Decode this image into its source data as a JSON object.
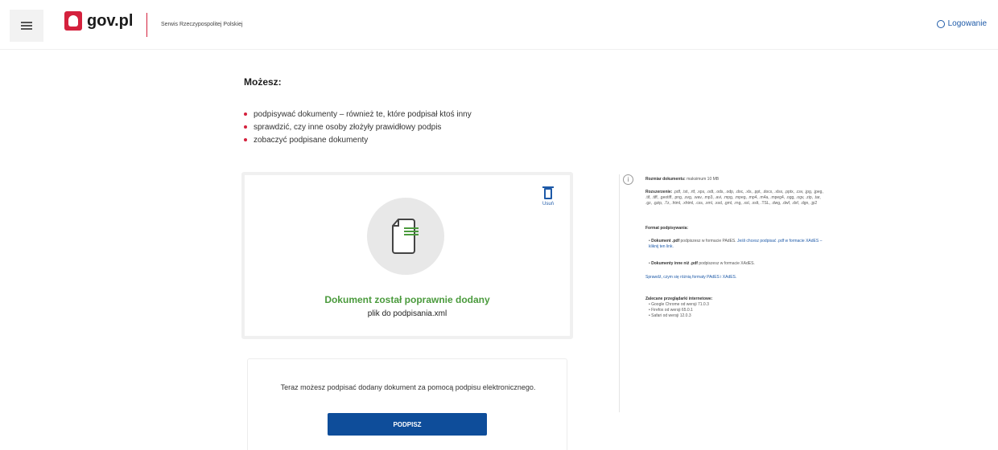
{
  "header": {
    "menu_icon": "hamburger-icon",
    "logo_text": "gov.pl",
    "service_name": "Serwis Rzeczypospolitej Polskiej",
    "login_label": "Logowanie",
    "colors": {
      "brand_red": "#d4213d",
      "link_blue": "#1e5aa8"
    }
  },
  "intro": {
    "title": "Możesz:",
    "items": [
      "podpisywać dokumenty – również te, które podpisał ktoś inny",
      "sprawdzić, czy inne osoby złożyły prawidłowy podpis",
      "zobaczyć podpisane dokumenty"
    ]
  },
  "upload": {
    "delete_label": "Usuń",
    "status": "Dokument został poprawnie dodany",
    "filename": "plik do podpisania.xml",
    "status_color": "#4a9a3c"
  },
  "sign": {
    "text": "Teraz możesz podpisać dodany dokument za pomocą podpisu elektronicznego.",
    "button_label": "PODPISZ",
    "button_color": "#0e4d9a"
  },
  "info": {
    "size_label": "Rozmiar dokumentu:",
    "size_value": "maksimum 10 MB",
    "ext_label": "Rozszerzenie:",
    "ext_value": ".pdf, .txt, .rtf, .xps, .odt, .ods, .odp, .doc, .xls, .ppt, .docx, .xlsx, .pptx, .csv, .jpg, .jpeg, .tif, .tiff, .geotiff, .png, .svg, .wav, .mp3, .avi, .mpg, .mpeg, .mp4, .m4a, .mpeg4, .ogg, .ogv, .zip, .tar, .gz, .gzip, .7z, .html, .xhtml, .css, .xml, .xsd, .gml, .rng, .xsl, .xslt, .TSL, .dwg, .dwf, .dxf, .dgn, .jp2",
    "format_title": "Format podpisywania:",
    "format_pdf_label": "Dokument .pdf",
    "format_pdf_text": "podpiszesz w formacie PAdES.",
    "format_pdf_link": "Jeśli chcesz podpisać .pdf w formacie XAdES – kliknij ten link.",
    "format_other_label": "Dokumenty inne niż .pdf",
    "format_other_text": "podpiszesz w formacie XAdES.",
    "diff_link": "Sprawdź, czym się różnią formaty PAdES i XAdES.",
    "browsers_title": "Zalecane przeglądarki internetowe:",
    "browsers": [
      "Google Chrome od wersji 71.0.3",
      "Firefox od wersji 65.0.1",
      "Safari od wersji 12.0.3"
    ]
  }
}
